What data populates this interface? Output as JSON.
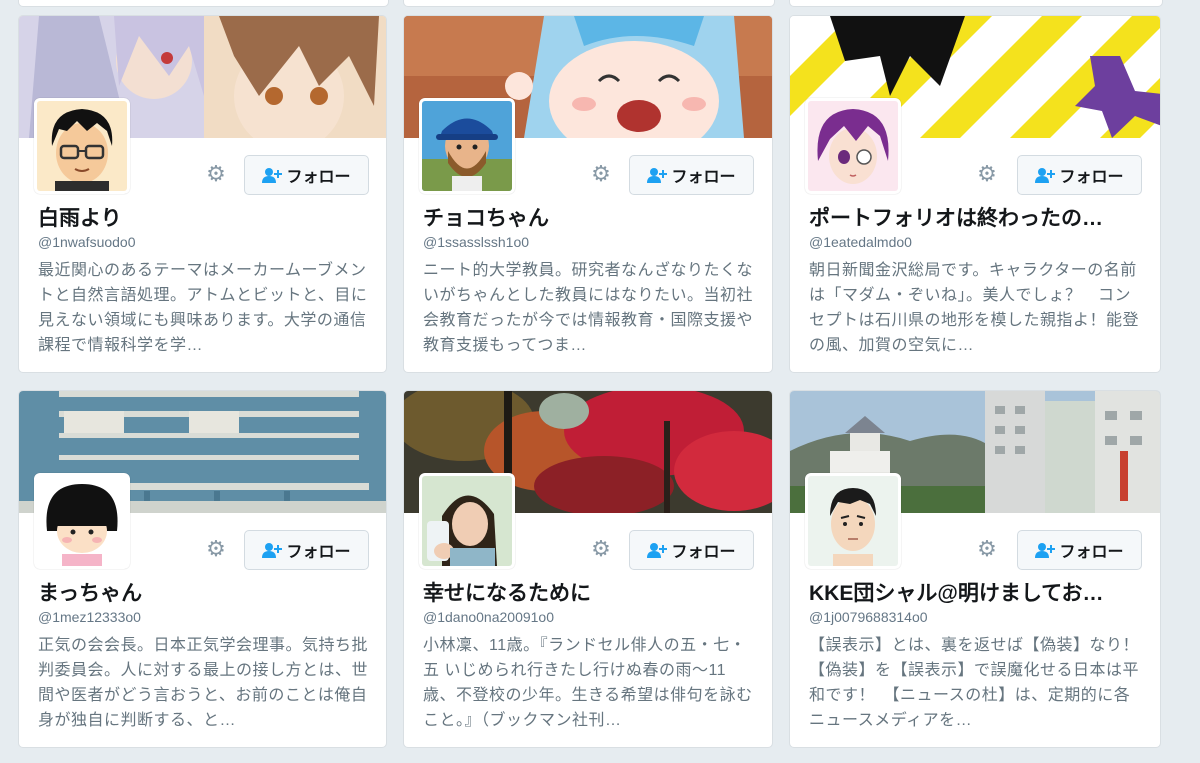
{
  "cards": [
    {
      "name": "白雨より",
      "handle": "@1nwafsuodo0",
      "bio": "最近関心のあるテーマはメーカームーブメントと自然言語処理。アトムとビットと、目に見えない領域にも興味あります。大学の通信課程で情報科学を学…",
      "follow_label": "フォロー"
    },
    {
      "name": "チョコちゃん",
      "handle": "@1ssasslssh1o0",
      "bio": "ニート的大学教員。研究者なんざなりたくないがちゃんとした教員にはなりたい。当初社会教育だったが今では情報教育・国際支援や教育支援もってつま…",
      "follow_label": "フォロー"
    },
    {
      "name": "ポートフォリオは終わったの…",
      "handle": "@1eatedalmdo0",
      "bio": "朝日新聞金沢総局です。キャラクターの名前は「マダム・ぞいね」。美人でしょ？　コンセプトは石川県の地形を模した親指よ！能登の風、加賀の空気に…",
      "follow_label": "フォロー"
    },
    {
      "name": "まっちゃん",
      "handle": "@1mez12333o0",
      "bio": "正気の会会長。日本正気学会理事。気持ち批判委員会。人に対する最上の接し方とは、世間や医者がどう言おうと、お前のことは俺自身が独自に判断する、と…",
      "follow_label": "フォロー"
    },
    {
      "name": "幸せになるために",
      "handle": "@1dano0na20091o0",
      "bio": "小林凜、11歳。『ランドセル俳人の五・七・五 いじめられ行きたし行けぬ春の雨～11歳、不登校の少年。生きる希望は俳句を詠むこと。』（ブックマン社刊…",
      "follow_label": "フォロー"
    },
    {
      "name": "KKE団シャル@明けましてお…",
      "handle": "@1j0079688314o0",
      "bio": "【誤表示】とは、裏を返せば【偽装】なり！　【偽装】を【誤表示】で誤魔化せる日本は平和です！　【ニュースの杜】は、定期的に各ニュースメディアを…",
      "follow_label": "フォロー"
    }
  ],
  "icons": {
    "settings": "gear-icon",
    "follow": "add-user-icon"
  },
  "colors": {
    "background": "#e6ecf0",
    "name": "#14171a",
    "muted": "#657786",
    "follow_icon": "#1da1f2"
  }
}
